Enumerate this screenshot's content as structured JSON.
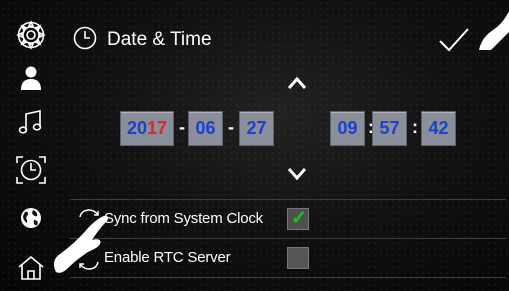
{
  "header": {
    "title": "Date & Time",
    "clock_icon": "clock-icon",
    "confirm_icon": "checkmark-icon"
  },
  "sidebar": {
    "items": [
      {
        "icon": "gear-icon"
      },
      {
        "icon": "user-icon"
      },
      {
        "icon": "music-note-icon"
      },
      {
        "icon": "clock-icon"
      },
      {
        "icon": "globe-icon"
      },
      {
        "icon": "home-icon"
      }
    ]
  },
  "datetime": {
    "year_prefix": "20",
    "year_suffix": "17",
    "month": "06",
    "day": "27",
    "hour": "09",
    "minute": "57",
    "second": "42",
    "date_separator": "-",
    "time_separator": ":"
  },
  "settings": [
    {
      "label": "Sync from System Clock",
      "checked": true,
      "check_glyph": "✓"
    },
    {
      "label": "Enable RTC Server",
      "checked": false
    }
  ],
  "colors": {
    "digit": "#1b42c7",
    "year_highlight": "#e02727",
    "box": "#8b8e9b",
    "checkmark": "#1ec61e"
  }
}
